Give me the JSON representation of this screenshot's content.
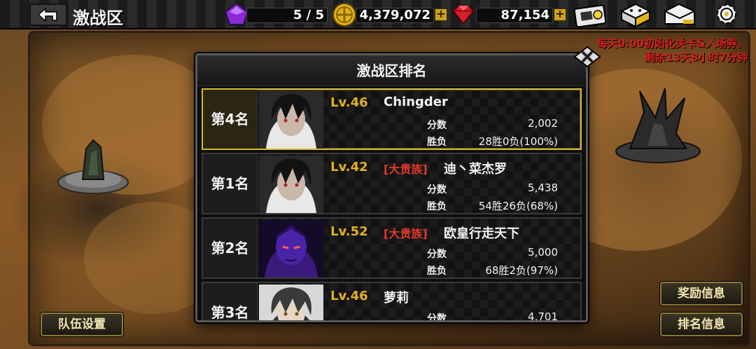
{
  "header": {
    "title": "激战区",
    "energy": "5 / 5",
    "gold": "4,379,072",
    "gems": "87,154",
    "icons": [
      "back-icon",
      "purple-crystal-icon",
      "gold-coin-icon",
      "red-gem-icon",
      "flashlight-icon",
      "dice-icon",
      "mail-icon",
      "settings-gear-icon"
    ]
  },
  "notice": {
    "line1": "每天0:00初始化关卡&入场券。",
    "line2": "剩余13天8小时7分钟"
  },
  "buttons": {
    "team": "队伍设置",
    "reward": "奖励信息",
    "ranking": "排名信息"
  },
  "panel": {
    "title": "激战区排名",
    "score_label": "分数",
    "record_label": "胜负",
    "rows": [
      {
        "rank": "第4名",
        "level": "Lv.46",
        "noble": "",
        "name": "Chingder",
        "score": "2,002",
        "record": "28胜0负(100%)",
        "highlight": true
      },
      {
        "rank": "第1名",
        "level": "Lv.42",
        "noble": "[大贵族]",
        "name": "迪丶菜杰罗",
        "score": "5,438",
        "record": "54胜26负(68%)",
        "highlight": false
      },
      {
        "rank": "第2名",
        "level": "Lv.52",
        "noble": "[大贵族]",
        "name": "欧皇行走天下",
        "score": "5,000",
        "record": "68胜2负(97%)",
        "highlight": false
      },
      {
        "rank": "第3名",
        "level": "Lv.46",
        "noble": "",
        "name": "萝莉",
        "score": "4,701",
        "record": "",
        "highlight": false
      }
    ]
  },
  "colors": {
    "level": "#e2b21c",
    "noble": "#e23a2a",
    "highlight_border": "#d4b83a",
    "notice": "#d42020"
  }
}
